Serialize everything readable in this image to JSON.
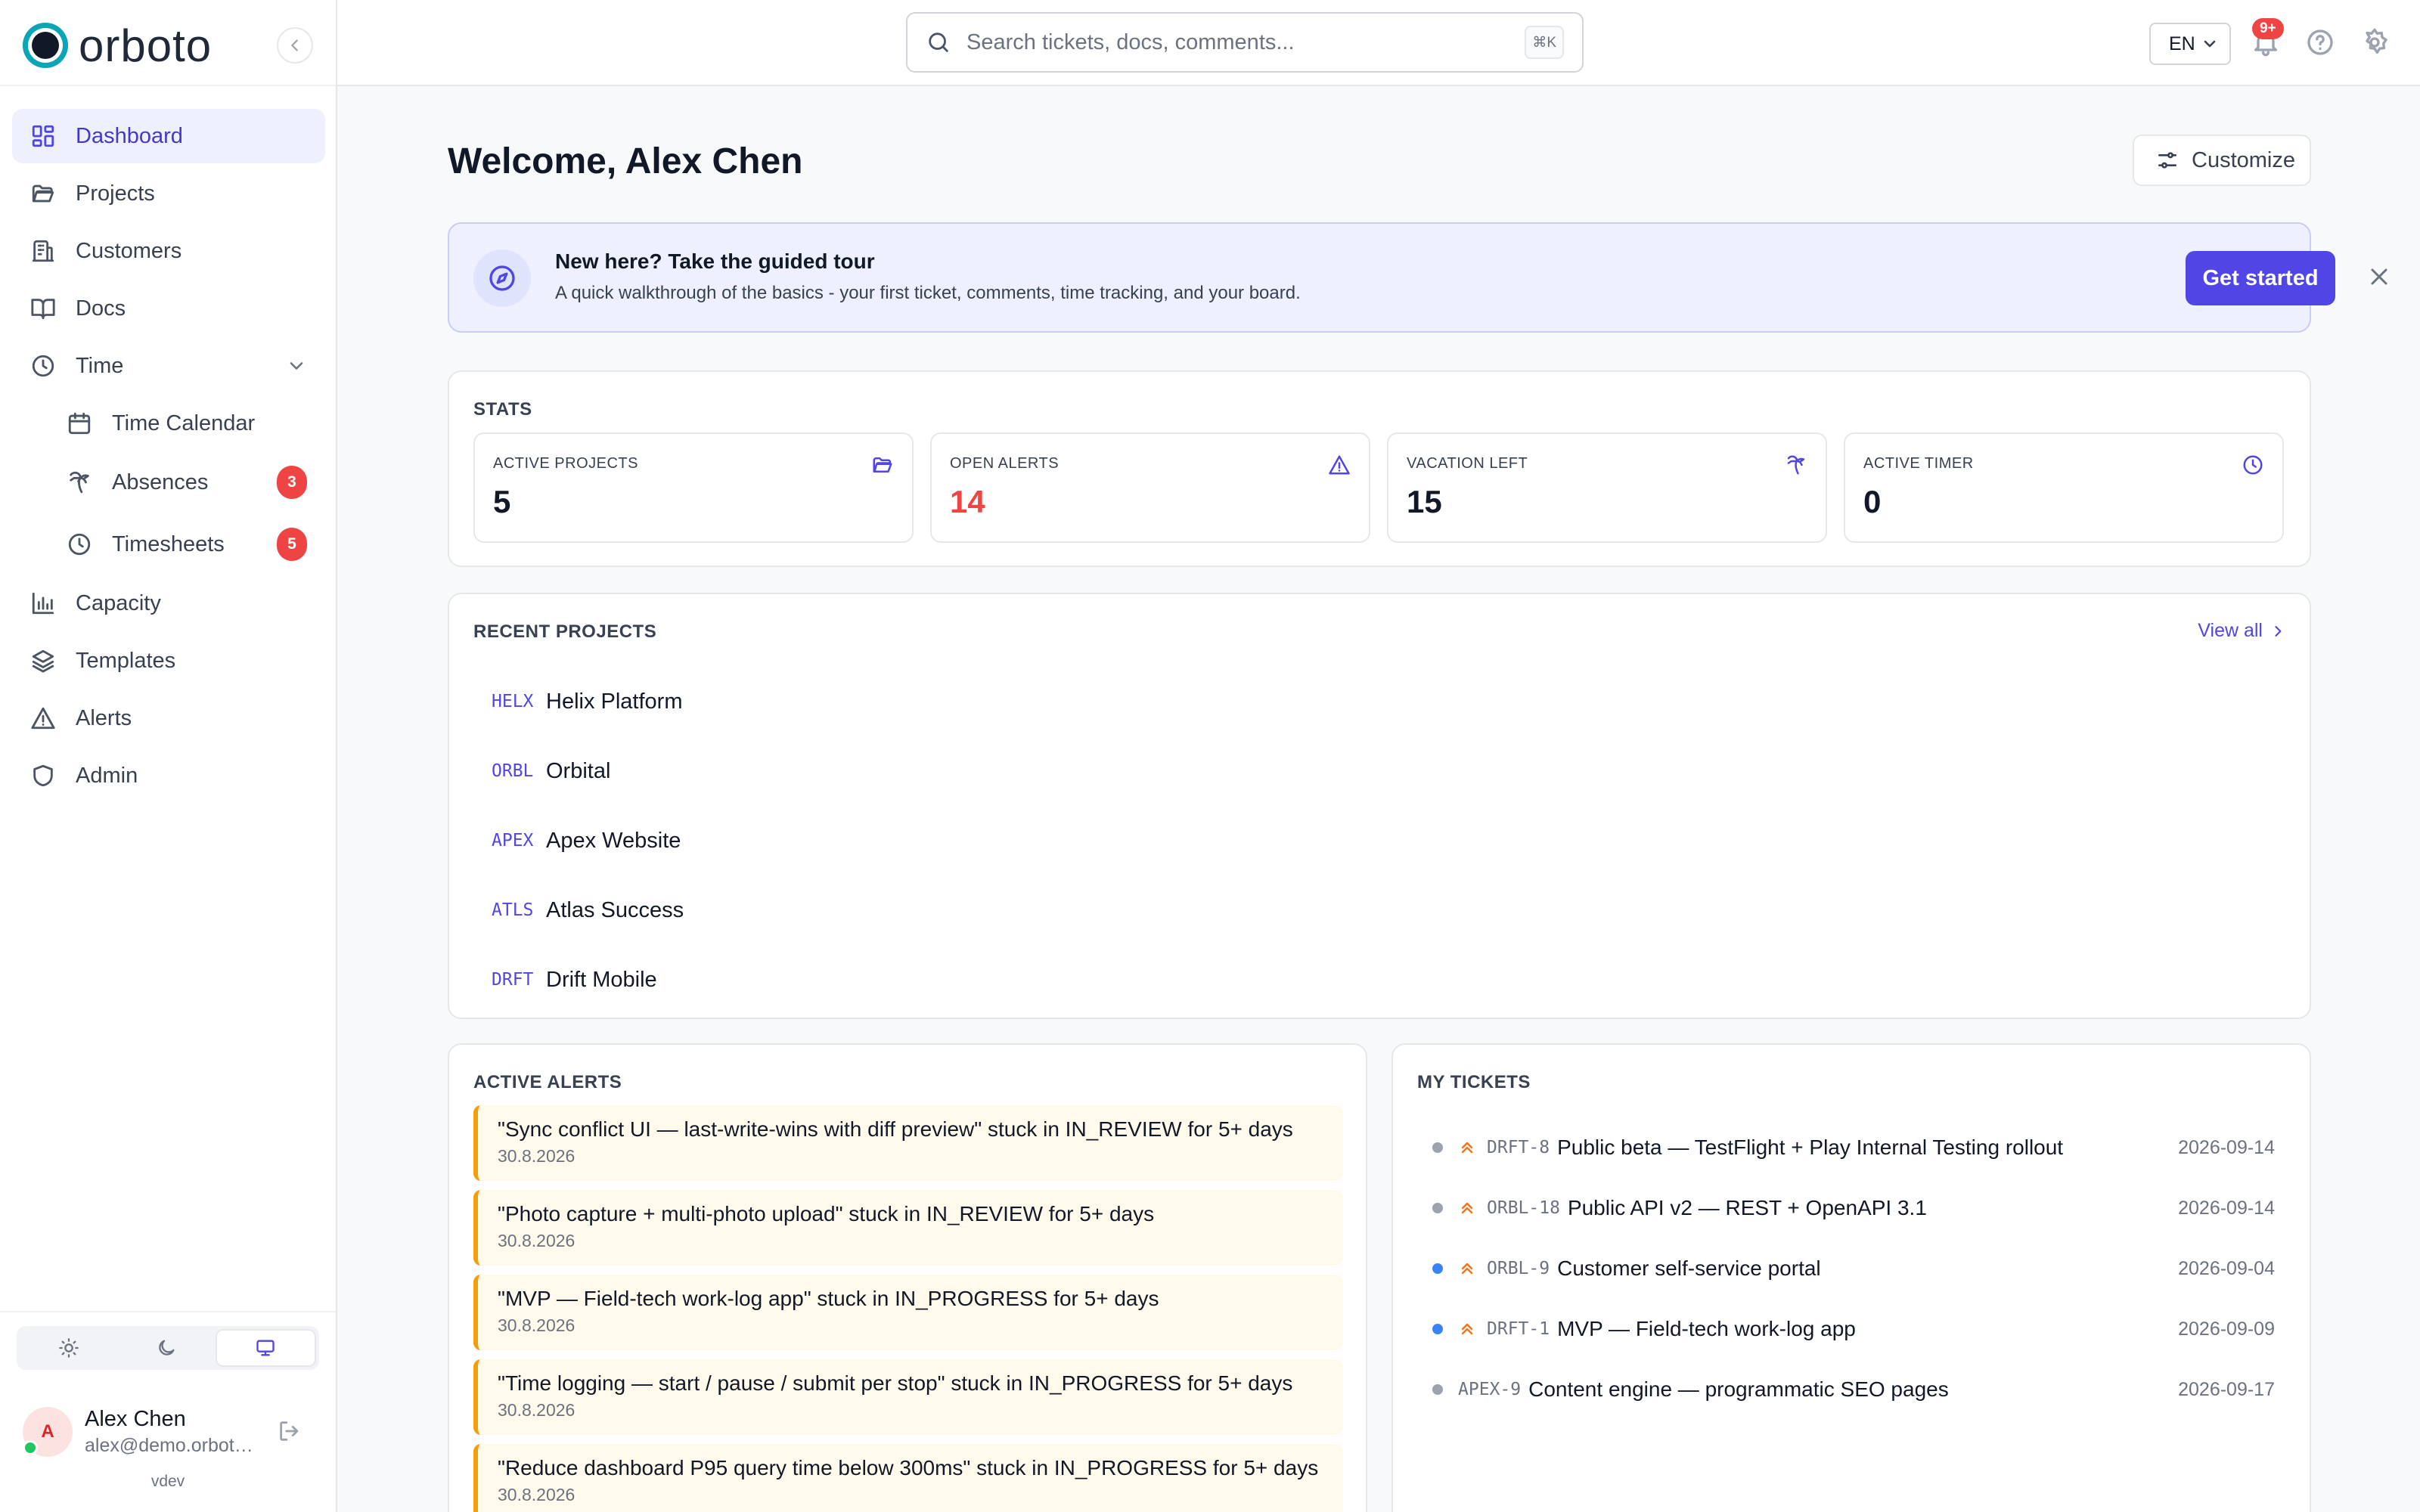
{
  "app": {
    "logo_text": "orboto"
  },
  "sidebar": {
    "items": [
      {
        "label": "Dashboard"
      },
      {
        "label": "Projects"
      },
      {
        "label": "Customers"
      },
      {
        "label": "Docs"
      },
      {
        "label": "Time"
      },
      {
        "label": "Time Calendar"
      },
      {
        "label": "Absences",
        "badge": "3"
      },
      {
        "label": "Timesheets",
        "badge": "5"
      },
      {
        "label": "Capacity"
      },
      {
        "label": "Templates"
      },
      {
        "label": "Alerts"
      },
      {
        "label": "Admin"
      }
    ],
    "user": {
      "initial": "A",
      "name": "Alex Chen",
      "email": "alex@demo.orboto.com"
    },
    "env": "vdev"
  },
  "topbar": {
    "search_placeholder": "Search tickets, docs, comments...",
    "search_shortcut": "⌘K",
    "language": "EN",
    "notification_badge": "9+"
  },
  "main": {
    "title": "Welcome, Alex Chen",
    "customize_label": "Customize",
    "tour": {
      "title": "New here? Take the guided tour",
      "description": "A quick walkthrough of the basics - your first ticket, comments, time tracking, and your board.",
      "button": "Get started"
    },
    "stats": {
      "title": "STATS",
      "items": [
        {
          "label": "ACTIVE PROJECTS",
          "value": "5"
        },
        {
          "label": "OPEN ALERTS",
          "value": "14"
        },
        {
          "label": "VACATION LEFT",
          "value": "15"
        },
        {
          "label": "ACTIVE TIMER",
          "value": "0"
        }
      ]
    },
    "recent_projects": {
      "title": "RECENT PROJECTS",
      "view_all": "View all",
      "items": [
        {
          "key": "HELX",
          "name": "Helix Platform"
        },
        {
          "key": "ORBL",
          "name": "Orbital"
        },
        {
          "key": "APEX",
          "name": "Apex Website"
        },
        {
          "key": "ATLS",
          "name": "Atlas Success"
        },
        {
          "key": "DRFT",
          "name": "Drift Mobile"
        }
      ]
    },
    "active_alerts": {
      "title": "ACTIVE ALERTS",
      "items": [
        {
          "text": "\"Sync conflict UI — last-write-wins with diff preview\" stuck in IN_REVIEW for 5+ days",
          "date": "30.8.2026"
        },
        {
          "text": "\"Photo capture + multi-photo upload\" stuck in IN_REVIEW for 5+ days",
          "date": "30.8.2026"
        },
        {
          "text": "\"MVP — Field-tech work-log app\" stuck in IN_PROGRESS for 5+ days",
          "date": "30.8.2026"
        },
        {
          "text": "\"Time logging — start / pause / submit per stop\" stuck in IN_PROGRESS for 5+ days",
          "date": "30.8.2026"
        },
        {
          "text": "\"Reduce dashboard P95 query time below 300ms\" stuck in IN_PROGRESS for 5+ days",
          "date": "30.8.2026"
        }
      ]
    },
    "my_tickets": {
      "title": "MY TICKETS",
      "items": [
        {
          "key": "DRFT-8",
          "title": "Public beta — TestFlight + Play Internal Testing rollout",
          "date": "2026-09-14",
          "status_color": "#9ca3af",
          "priority": "high"
        },
        {
          "key": "ORBL-18",
          "title": "Public API v2 — REST + OpenAPI 3.1",
          "date": "2026-09-14",
          "status_color": "#9ca3af",
          "priority": "high"
        },
        {
          "key": "ORBL-9",
          "title": "Customer self-service portal",
          "date": "2026-09-04",
          "status_color": "#3b82f6",
          "priority": "high"
        },
        {
          "key": "DRFT-1",
          "title": "MVP — Field-tech work-log app",
          "date": "2026-09-09",
          "status_color": "#3b82f6",
          "priority": "high"
        },
        {
          "key": "APEX-9",
          "title": "Content engine — programmatic SEO pages",
          "date": "2026-09-17",
          "status_color": "#9ca3af",
          "priority": "none"
        }
      ]
    }
  },
  "colors": {
    "accent": "#4f46e5",
    "danger": "#ef4444",
    "warning": "#f59e0b",
    "brand": "#0aa6b5"
  }
}
